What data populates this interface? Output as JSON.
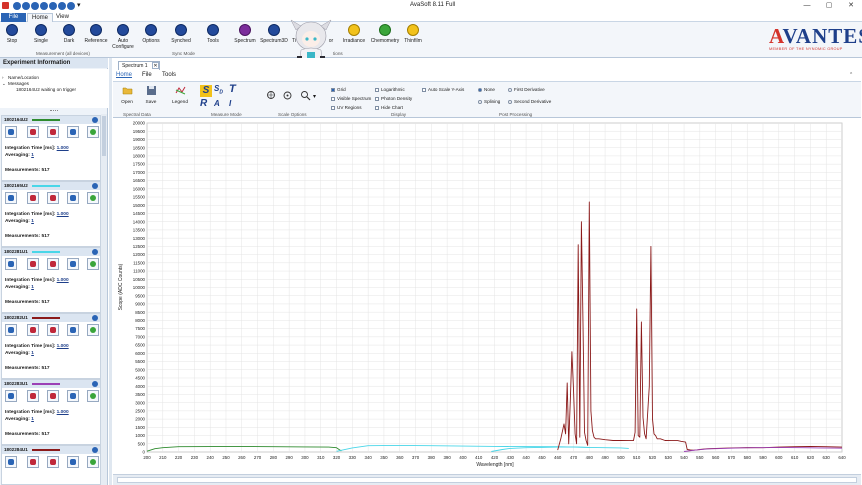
{
  "app": {
    "title": "AvaSoft 8.11 Full",
    "window_controls": [
      "—",
      "▢",
      "✕"
    ]
  },
  "menu": {
    "file": "File",
    "tabs": [
      "Home",
      "View"
    ]
  },
  "ribbon": {
    "buttons": [
      {
        "label": "Stop",
        "icon": "stop-icon"
      },
      {
        "label": "Single",
        "icon": "single-icon"
      },
      {
        "label": "Dark",
        "icon": "dark-icon"
      },
      {
        "label": "Reference",
        "icon": "reference-icon"
      },
      {
        "label": "Auto\nConfigure",
        "icon": "auto-configure-icon"
      },
      {
        "label": "Options",
        "icon": "options-icon"
      },
      {
        "label": "Synched",
        "icon": "synched-icon"
      },
      {
        "label": "Tools",
        "icon": "tools-icon"
      },
      {
        "label": "Spectrum",
        "icon": "spectrum-icon"
      },
      {
        "label": "Spectrum3D",
        "icon": "spectrum3d-icon"
      },
      {
        "label": "Ti",
        "icon": "time-icon"
      },
      {
        "label": "or",
        "icon": "color-icon"
      },
      {
        "label": "Irradiance",
        "icon": "irradiance-icon"
      },
      {
        "label": "Chemometry",
        "icon": "chemometry-icon"
      },
      {
        "label": "Thinfilm",
        "icon": "thinfilm-icon"
      }
    ],
    "groups": [
      "Measurement (all devices)",
      "Sync Mode",
      "tions"
    ]
  },
  "logo": {
    "brand_prefix": "A",
    "brand_rest": "VANTES",
    "tagline": "MEMBER OF THE NYNOMIC GROUP"
  },
  "experiment": {
    "header": "Experiment Information",
    "tree": [
      "Name/Location",
      "Messages",
      "1802164U2 waiting on trigger"
    ]
  },
  "devices": [
    {
      "id": "1802164U2",
      "swatch": "#2e8b2e",
      "integration": "1.000",
      "averaging": "1",
      "measurements": "517"
    },
    {
      "id": "1802165U2",
      "swatch": "#49d6e8",
      "integration": "1.000",
      "averaging": "1",
      "measurements": "517"
    },
    {
      "id": "1802281U1",
      "swatch": "#49d6e8",
      "integration": "1.000",
      "averaging": "1",
      "measurements": "517"
    },
    {
      "id": "1802282U1",
      "swatch": "#8b1a1a",
      "integration": "1.000",
      "averaging": "1",
      "measurements": "517"
    },
    {
      "id": "1802283U1",
      "swatch": "#9b3fb5",
      "integration": "1.000",
      "averaging": "1",
      "measurements": "517"
    },
    {
      "id": "1802284U1",
      "swatch": "#8b1a1a",
      "integration": "",
      "averaging": "",
      "measurements": ""
    }
  ],
  "device_labels": {
    "integration": "Integration Time [ms]:",
    "averaging": "Averaging:",
    "measurements": "Measurements:"
  },
  "document": {
    "tab": "Spectrum 1",
    "close": "✕",
    "subtabs": [
      "Home",
      "File",
      "Tools"
    ]
  },
  "chart_ribbon": {
    "open": "Open",
    "save": "Save",
    "legend": "Legend",
    "measure_letters": [
      "S",
      "R",
      "A",
      "A",
      "T",
      "I"
    ],
    "checks": [
      {
        "label": "Grid",
        "on": true
      },
      {
        "label": "Visible Spectrum",
        "on": false
      },
      {
        "label": "UV Regions",
        "on": false
      },
      {
        "label": "Logarithmic",
        "on": false
      },
      {
        "label": "Photon Density",
        "on": false
      },
      {
        "label": "Hide Chart",
        "on": false
      },
      {
        "label": "Auto Scale Y-Axis",
        "on": false
      }
    ],
    "post": [
      {
        "label": "None",
        "on": true
      },
      {
        "label": "First Derivative",
        "on": false
      },
      {
        "label": "Splining",
        "on": false
      },
      {
        "label": "Second Derivative",
        "on": false
      }
    ],
    "groups": [
      "Spectral Data",
      "Measure Mode",
      "Scale Options",
      "Display",
      "Post Processing"
    ]
  },
  "chart_data": {
    "type": "line",
    "xlabel": "Wavelength [nm]",
    "ylabel": "Scope (ADC Counts)",
    "xlim": [
      200,
      640
    ],
    "ylim": [
      0,
      20000
    ],
    "x_ticks": [
      200,
      210,
      220,
      230,
      240,
      250,
      260,
      270,
      280,
      290,
      300,
      310,
      320,
      330,
      340,
      350,
      360,
      370,
      380,
      390,
      400,
      410,
      420,
      430,
      440,
      450,
      460,
      470,
      480,
      490,
      500,
      510,
      520,
      530,
      540,
      550,
      560,
      570,
      580,
      590,
      600,
      610,
      620,
      630,
      640
    ],
    "y_ticks": [
      0,
      500,
      1000,
      1500,
      2000,
      2500,
      3000,
      3500,
      4000,
      4500,
      5000,
      5500,
      6000,
      6500,
      7000,
      7500,
      8000,
      8500,
      9000,
      9500,
      10000,
      10500,
      11000,
      11500,
      12000,
      12500,
      13000,
      13500,
      14000,
      14500,
      15000,
      15500,
      16000,
      16500,
      17000,
      17500,
      18000,
      18500,
      19000,
      19500,
      20000
    ],
    "grid": true,
    "series": [
      {
        "color": "#2e8b2e",
        "x": [
          200,
          205,
          210,
          220,
          240,
          260,
          280,
          300,
          315,
          320,
          323
        ],
        "y": [
          50,
          200,
          260,
          320,
          330,
          340,
          320,
          310,
          300,
          260,
          60
        ]
      },
      {
        "color": "#49d6e8",
        "x": [
          320,
          330,
          340,
          360,
          380,
          400,
          420,
          440,
          460,
          470,
          480,
          490,
          500,
          505
        ],
        "y": [
          40,
          250,
          380,
          400,
          380,
          360,
          340,
          330,
          320,
          300,
          280,
          260,
          250,
          220
        ]
      },
      {
        "color": "#49d6e8",
        "x": [
          418,
          425,
          430,
          440,
          450,
          460,
          470,
          480
        ],
        "y": [
          30,
          150,
          220,
          260,
          280,
          300,
          310,
          280
        ]
      },
      {
        "color": "#8b1a1a",
        "x": [
          460,
          462,
          464,
          465,
          466,
          467,
          468,
          469,
          470,
          471,
          472,
          473,
          474,
          475,
          476,
          477,
          478,
          479,
          480,
          481,
          482,
          483,
          484,
          486,
          490,
          495,
          500,
          505,
          508,
          509,
          510,
          511,
          512,
          513,
          514,
          515,
          516,
          517,
          518,
          519,
          520,
          521,
          522,
          523,
          524,
          525,
          528,
          532,
          536,
          538,
          540,
          541,
          542,
          544,
          546,
          548,
          550,
          555,
          560,
          570,
          580,
          590,
          600,
          610,
          620,
          630,
          640
        ],
        "y": [
          120,
          800,
          1700,
          1100,
          4200,
          500,
          3100,
          6100,
          3800,
          1100,
          500,
          12600,
          900,
          14000,
          7800,
          1200,
          700,
          400,
          15200,
          2500,
          1300,
          900,
          800,
          800,
          750,
          700,
          700,
          690,
          700,
          1200,
          8700,
          1000,
          900,
          7900,
          2100,
          1100,
          800,
          2400,
          4000,
          12500,
          2000,
          1100,
          1000,
          800,
          800,
          800,
          700,
          690,
          690,
          650,
          620,
          600,
          150,
          120,
          110,
          130,
          150,
          200,
          220,
          250,
          270,
          260,
          300,
          320,
          340,
          320,
          300
        ]
      },
      {
        "color": "#9b3fb5",
        "x": [
          540,
          548,
          555,
          565,
          575,
          585,
          595,
          605,
          615,
          625,
          635,
          640
        ],
        "y": [
          30,
          130,
          190,
          220,
          250,
          260,
          270,
          270,
          260,
          250,
          240,
          230
        ]
      }
    ]
  }
}
